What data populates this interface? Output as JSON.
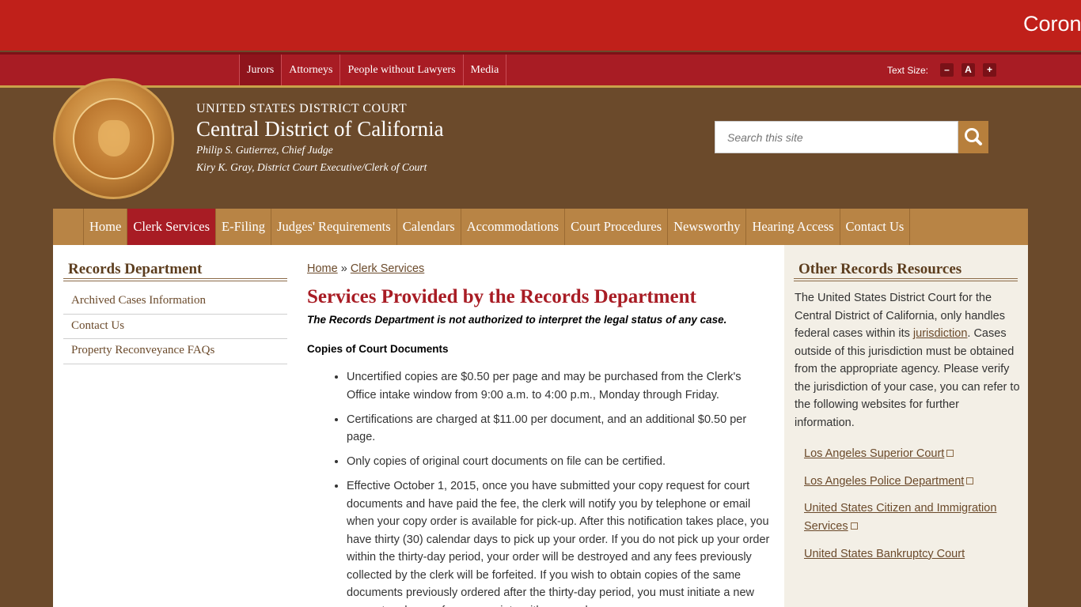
{
  "alert": {
    "text": "Coron"
  },
  "utility_nav": {
    "items": [
      "Jurors",
      "Attorneys",
      "People without Lawyers",
      "Media"
    ],
    "text_size_label": "Text Size:",
    "text_size_buttons": [
      "–",
      "A",
      "+"
    ]
  },
  "header": {
    "line1": "UNITED STATES DISTRICT COURT",
    "line2": "Central District of California",
    "line3": "Philip S. Gutierrez, Chief Judge",
    "line4": "Kiry K. Gray, District Court Executive/Clerk of Court",
    "search_placeholder": "Search this site"
  },
  "main_nav": {
    "items": [
      "Home",
      "Clerk Services",
      "E-Filing",
      "Judges' Requirements",
      "Calendars",
      "Accommodations",
      "Court Procedures",
      "Newsworthy",
      "Hearing Access",
      "Contact Us"
    ],
    "active": "Clerk Services"
  },
  "left_sidebar": {
    "title": "Records Department",
    "items": [
      "Archived Cases Information",
      "Contact Us",
      "Property Reconveyance FAQs"
    ]
  },
  "main": {
    "breadcrumb": {
      "home": "Home",
      "sep": "»",
      "current": "Clerk Services"
    },
    "title": "Services Provided by the Records Department",
    "note": "The Records Department is not authorized to interpret the legal status of any case.",
    "subheading": "Copies of Court Documents",
    "bullets": [
      "Uncertified copies are $0.50 per page and may be purchased from the Clerk's Office intake window from 9:00 a.m. to 4:00 p.m., Monday through Friday.",
      "Certifications are charged at $11.00 per document, and an additional $0.50 per page.",
      "Only copies of original court documents on file can be certified.",
      "Effective October 1, 2015, once you have submitted your copy request for court documents and have paid the fee, the clerk will notify you by telephone or email when your copy order is available for pick-up. After this notification takes place, you have thirty (30) calendar days to pick up your order. If you do not pick up your order within the thirty-day period, your order will be destroyed and any fees previously collected by the clerk will be forfeited. If you wish to obtain copies of the same documents previously ordered after the thirty-day period, you must initiate a new request and pay a fee appropriate with your order."
    ]
  },
  "right_sidebar": {
    "title": "Other Records Resources",
    "para_before": "The United States District Court for the Central District of California, only handles federal cases within its ",
    "para_link": "jurisdiction",
    "para_after": ". Cases outside of this jurisdiction must be obtained from the appropriate agency. Please verify the jurisdiction of your case, you can refer to the following websites for further information.",
    "links": [
      {
        "label": "Los Angeles Superior Court",
        "external": true
      },
      {
        "label": "Los Angeles Police Department",
        "external": true
      },
      {
        "label": "United States Citizen and Immigration Services",
        "external": true
      },
      {
        "label": "United States Bankruptcy Court",
        "external": false
      }
    ]
  },
  "colors": {
    "alert_red": "#c0201a",
    "utility_red": "#a81c24",
    "header_brown": "#6b4a2b",
    "nav_tan": "#b88445",
    "title_red": "#a81c24"
  }
}
